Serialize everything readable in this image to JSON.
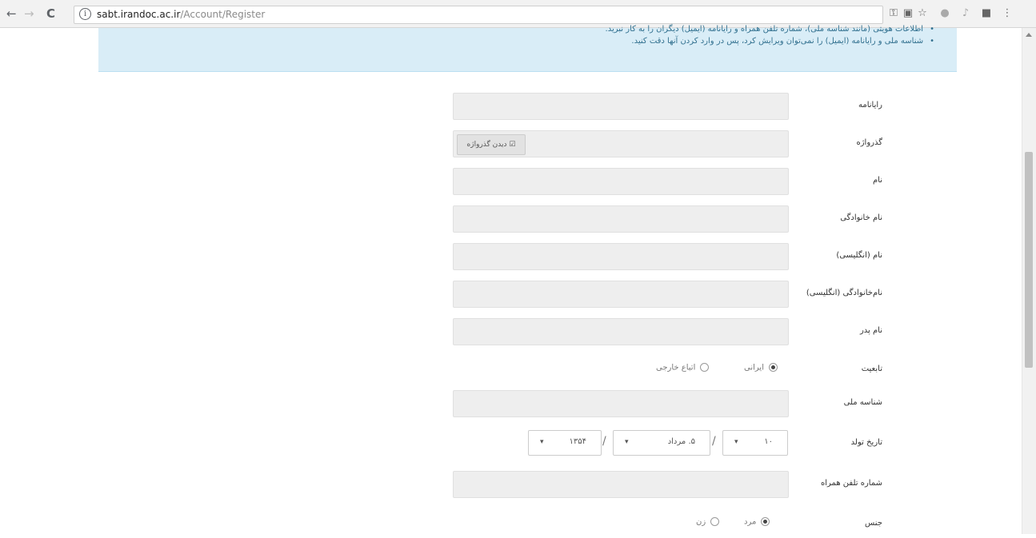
{
  "browser": {
    "url_host": "sabt.irandoc.ac.ir",
    "url_path": "/Account/Register",
    "back": "←",
    "forward": "→",
    "reload": "C",
    "info": "i"
  },
  "notice": {
    "lines": [
      "اطلاعات هویتی (مانند شناسه ملی)، شماره تلفن همراه و رایانامه (ایمیل) دیگران را به کار نبرید.",
      "شناسه ملی و رایانامه (ایمیل) را نمی‌توان ویرایش کرد، پس در وارد کردن آنها دقت کنید."
    ]
  },
  "form": {
    "email_label": "رایانامه",
    "password_label": "گذرواژه",
    "show_password": "دیدن گذرواژه",
    "name_label": "نام",
    "lastname_label": "نام خانوادگی",
    "name_en_label": "نام (انگلیسی)",
    "lastname_en_label": "نام‌خانوادگی (انگلیسی)",
    "father_label": "نام پدر",
    "nationality_label": "تابعیت",
    "nationality_iranian": "ایرانی",
    "nationality_foreign": "اتباع خارجی",
    "national_id_label": "شناسه ملی",
    "birthdate_label": "تاریخ تولد",
    "birth_day": "۱۰",
    "birth_month": "۵. مرداد",
    "birth_year": "۱۳۵۴",
    "date_sep": "/",
    "mobile_label": "شماره تلفن همراه",
    "gender_label": "جنس",
    "gender_male": "مرد",
    "gender_female": "زن"
  }
}
